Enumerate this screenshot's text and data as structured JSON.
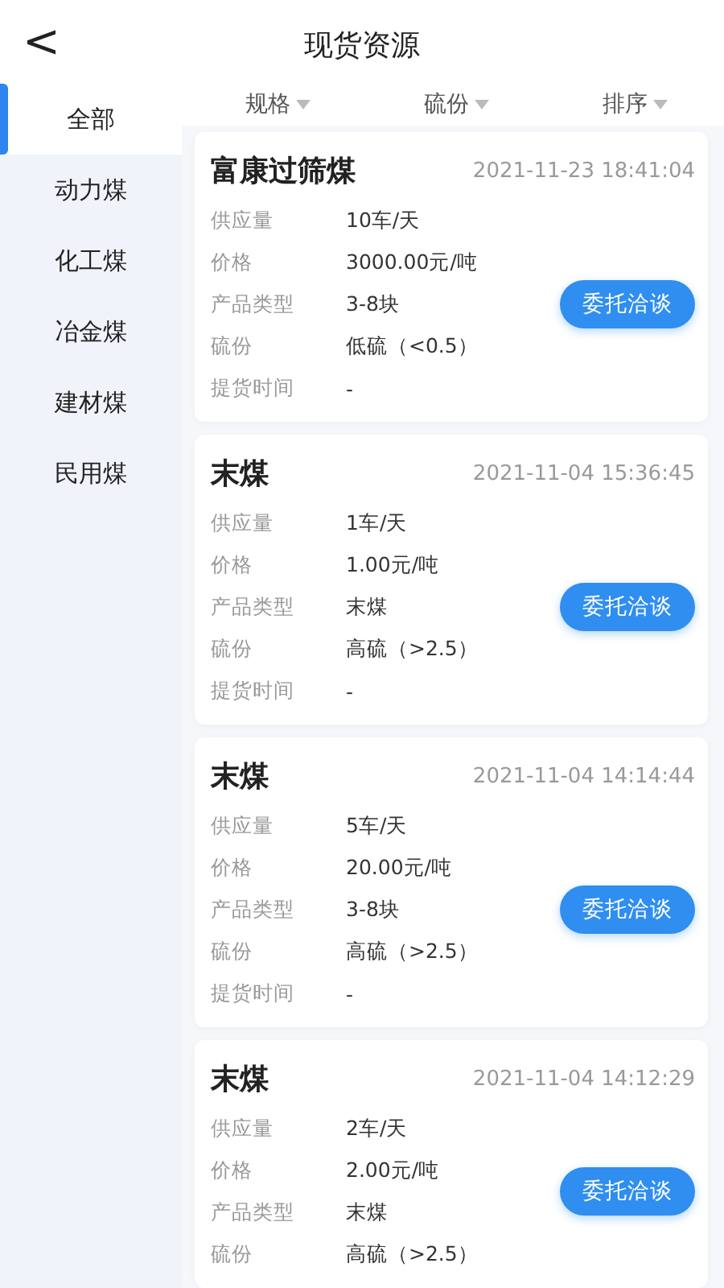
{
  "header": {
    "back_icon": "<",
    "title": "现货资源"
  },
  "sidebar": {
    "items": [
      {
        "label": "全部",
        "selected": true
      },
      {
        "label": "动力煤",
        "selected": false
      },
      {
        "label": "化工煤",
        "selected": false
      },
      {
        "label": "冶金煤",
        "selected": false
      },
      {
        "label": "建材煤",
        "selected": false
      },
      {
        "label": "民用煤",
        "selected": false
      }
    ]
  },
  "filters": [
    {
      "label": "规格"
    },
    {
      "label": "硫份"
    },
    {
      "label": "排序"
    }
  ],
  "listings": [
    {
      "name": "富康过筛煤",
      "time": "2021-11-23 18:41:04",
      "fields": [
        {
          "label": "供应量",
          "value": "10车/天"
        },
        {
          "label": "价格",
          "value": "3000.00元/吨"
        },
        {
          "label": "产品类型",
          "value": "3-8块"
        },
        {
          "label": "硫份",
          "value": "低硫（<0.5）"
        },
        {
          "label": "提货时间",
          "value": "-"
        }
      ],
      "button": "委托洽谈"
    },
    {
      "name": "末煤",
      "time": "2021-11-04 15:36:45",
      "fields": [
        {
          "label": "供应量",
          "value": "1车/天"
        },
        {
          "label": "价格",
          "value": "1.00元/吨"
        },
        {
          "label": "产品类型",
          "value": "末煤"
        },
        {
          "label": "硫份",
          "value": "高硫（>2.5）"
        },
        {
          "label": "提货时间",
          "value": "-"
        }
      ],
      "button": "委托洽谈"
    },
    {
      "name": "末煤",
      "time": "2021-11-04 14:14:44",
      "fields": [
        {
          "label": "供应量",
          "value": "5车/天"
        },
        {
          "label": "价格",
          "value": "20.00元/吨"
        },
        {
          "label": "产品类型",
          "value": "3-8块"
        },
        {
          "label": "硫份",
          "value": "高硫（>2.5）"
        },
        {
          "label": "提货时间",
          "value": "-"
        }
      ],
      "button": "委托洽谈"
    },
    {
      "name": "末煤",
      "time": "2021-11-04 14:12:29",
      "fields": [
        {
          "label": "供应量",
          "value": "2车/天"
        },
        {
          "label": "价格",
          "value": "2.00元/吨"
        },
        {
          "label": "产品类型",
          "value": "末煤"
        },
        {
          "label": "硫份",
          "value": "高硫（>2.5）"
        }
      ],
      "button": "委托洽谈"
    }
  ]
}
